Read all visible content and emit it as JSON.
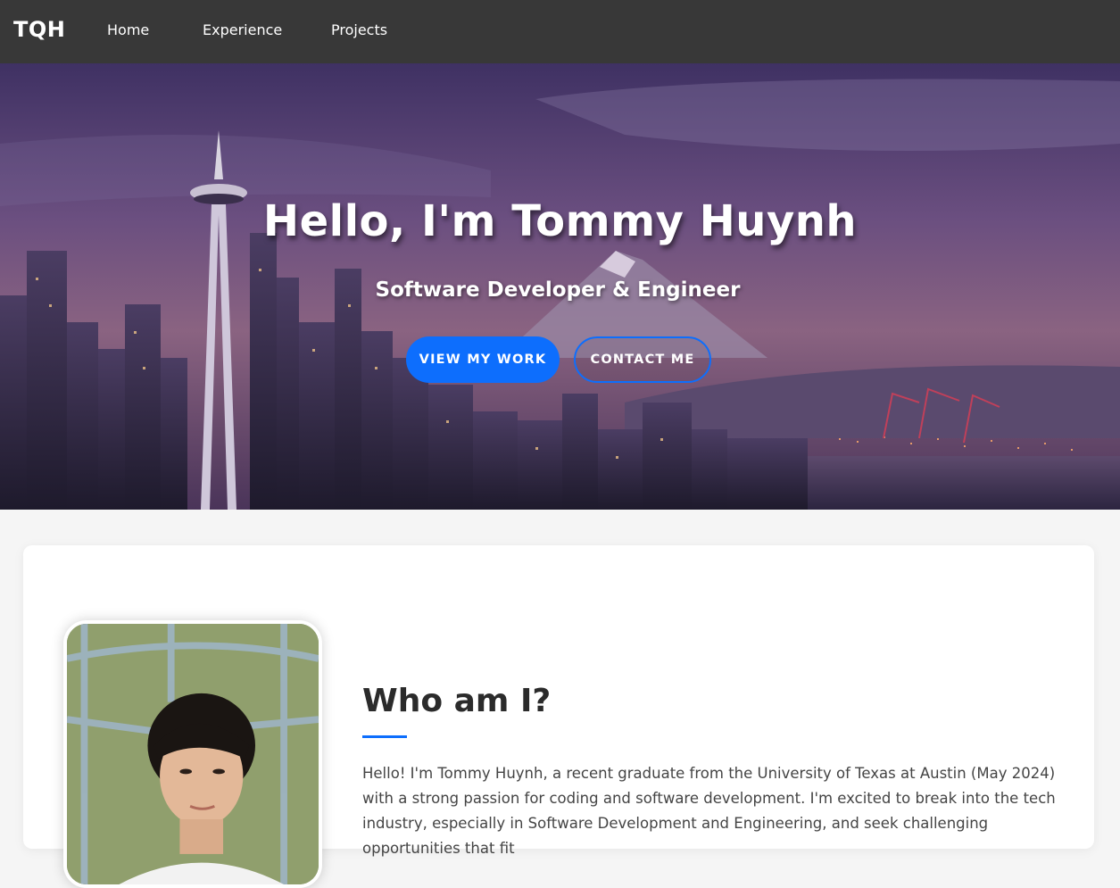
{
  "nav": {
    "brand": "TQH",
    "links": [
      "Home",
      "Experience",
      "Projects"
    ]
  },
  "hero": {
    "title": "Hello, I'm Tommy Huynh",
    "subtitle": "Software Developer & Engineer",
    "primary_button": "VIEW MY WORK",
    "secondary_button": "CONTACT ME"
  },
  "about": {
    "heading": "Who am I?",
    "paragraph": "Hello! I'm Tommy Huynh, a recent graduate from the University of Texas at Austin (May 2024) with a strong passion for coding and software development. I'm excited to break into the tech industry, especially in Software Development and Engineering, and seek challenging opportunities that fit"
  },
  "colors": {
    "nav_bg": "#383838",
    "accent": "#0d6efd",
    "page_bg": "#f5f5f5",
    "card_bg": "#ffffff"
  }
}
